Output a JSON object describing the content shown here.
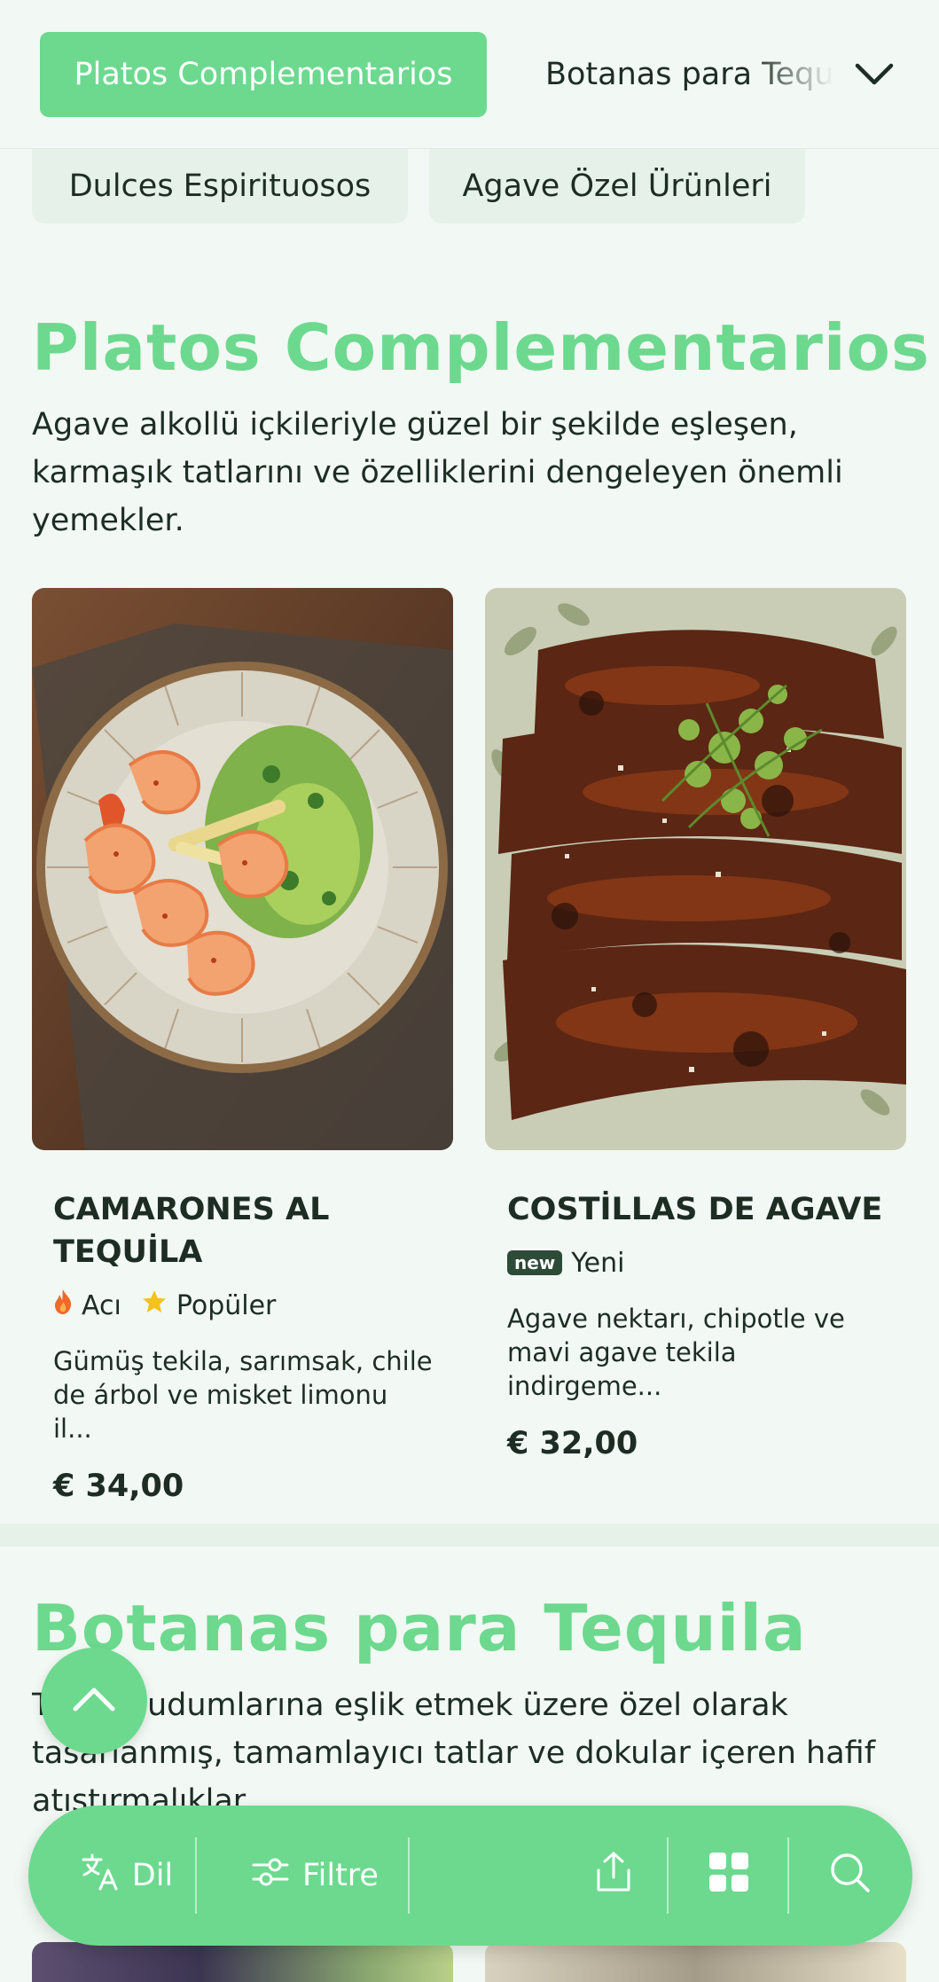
{
  "nav": {
    "active_category": "Platos Complementarios",
    "next_category": "Botanas para Tequila",
    "expand_icon": "chevron-down-icon",
    "sub_categories": [
      "Dulces Espirituosos",
      "Agave Özel Ürünleri"
    ]
  },
  "section": {
    "title": "Platos Complementarios",
    "description": "Agave alkollü içkileriyle güzel bir şekilde eşleşen, karmaşık tatlarını ve özelliklerini dengeleyen önemli yemekler."
  },
  "products": [
    {
      "name": "CAMARONES AL TEQUİLA",
      "tags": [
        {
          "icon": "flame-icon",
          "label": "Acı"
        },
        {
          "icon": "star-icon",
          "label": "Popüler"
        }
      ],
      "description": "Gümüş tekila, sarımsak, chile de árbol ve misket limonu il...",
      "price": "€ 34,00"
    },
    {
      "name": "COSTİLLAS DE AGAVE",
      "badge": "new",
      "badge_label": "Yeni",
      "description": "Agave nektarı, chipotle ve mavi agave tekila indirgeme...",
      "price": "€ 32,00"
    }
  ],
  "section2": {
    "title": "Botanas para Tequila",
    "description": "Tekila yudumlarına eşlik etmek üzere özel olarak tasarlanmış, tamamlayıcı tatlar ve dokular içeren hafif atıştırmalıklar."
  },
  "bottom_bar": {
    "language_label": "Dil",
    "language_icon": "translate-icon",
    "filter_label": "Filtre",
    "filter_icon": "sliders-icon",
    "share_icon": "share-icon",
    "grid_icon": "grid-icon",
    "search_icon": "search-icon"
  },
  "scroll_top_icon": "chevron-up-icon",
  "colors": {
    "accent": "#6cd98f",
    "background": "#f2f8f3",
    "text": "#1d2d24",
    "chip_bg": "#e6f1e9"
  }
}
